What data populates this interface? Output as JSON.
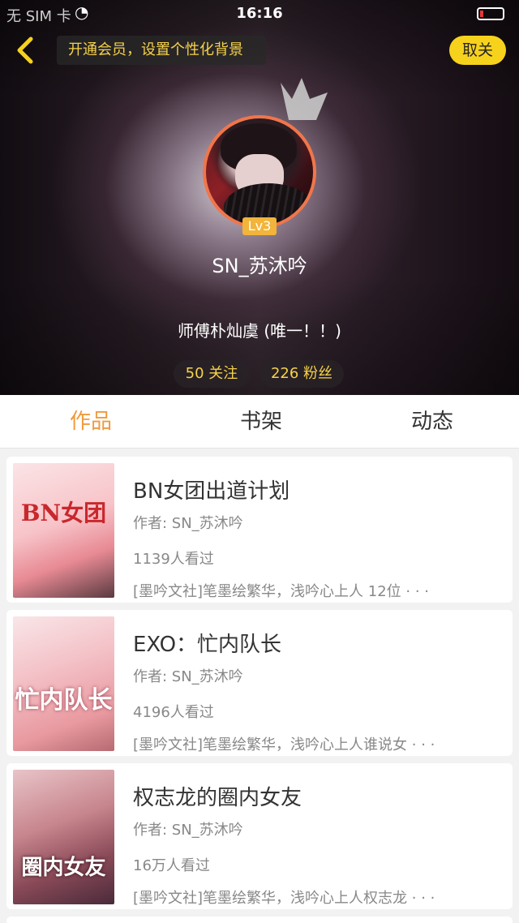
{
  "status_bar": {
    "carrier": "无 SIM 卡",
    "time": "16:16"
  },
  "header": {
    "banner": "开通会员，设置个性化背景",
    "unfollow_label": "取关",
    "level": "Lv3",
    "username": "SN_苏沐吟",
    "motto": "师傅朴灿虞 (唯一！！)",
    "following": "50 关注",
    "fans": "226 粉丝"
  },
  "tabs": [
    "作品",
    "书架",
    "动态"
  ],
  "active_tab": "作品",
  "works": [
    {
      "title": "BN女团出道计划",
      "author": "作者: SN_苏沐吟",
      "views": "1139人看过",
      "desc": "[墨吟文社]笔墨绘繁华，浅吟心上人 12位 · · ·",
      "cover_text": "BN女团"
    },
    {
      "title": "EXO：忙内队长",
      "author": "作者: SN_苏沐吟",
      "views": "4196人看过",
      "desc": "[墨吟文社]笔墨绘繁华，浅吟心上人谁说女 · · ·",
      "cover_text": "忙内队长"
    },
    {
      "title": "权志龙的圈内女友",
      "author": "作者: SN_苏沐吟",
      "views": "16万人看过",
      "desc": "[墨吟文社]笔墨绘繁华，浅吟心上人权志龙 · · ·",
      "cover_text": "圈内女友"
    }
  ],
  "colors": {
    "accent": "#f09a3e",
    "yellow_button": "#f7d21c",
    "level_badge": "#f2b43a",
    "avatar_border": "#f0764a",
    "stat_text": "#f6d24a"
  }
}
